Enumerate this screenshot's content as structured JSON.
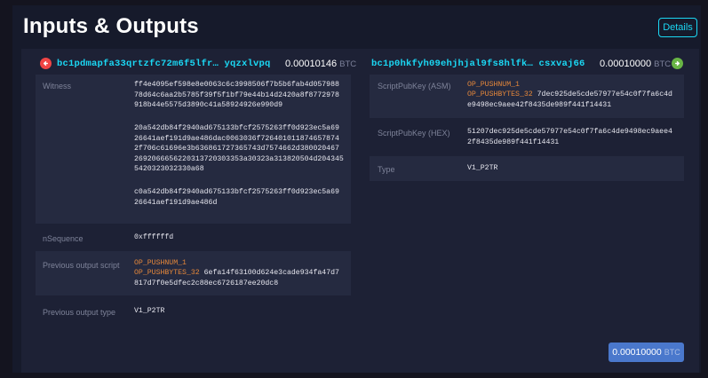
{
  "header": {
    "title": "Inputs & Outputs",
    "details_label": "Details"
  },
  "input": {
    "address": "bc1pdmapfa33qrtzfc72m6f5lfr… yqzxlvpq",
    "amount": "0.00010146",
    "unit": "BTC",
    "witness_label": "Witness",
    "witness_1": "ff4e4095ef598e8e0063c6c3998506f7b5b6fab4d057988\n78d64c6aa2b5785f39f5f1bf79e44b14d2420a8f8772978\n918b44e5575d3890c41a58924926e990d9",
    "witness_2": "20a542db84f2940ad675133bfcf2575263ff0d923ec5a69\n26641aef191d9ae486dac0063036f726401011874657874\n2f706c61696e3b636861727365743d7574662d380020467\n2692066656220313720303353a30323a313820504d204345\n5420323032330a68",
    "witness_3": "c0a542db84f2940ad675133bfcf2575263ff0d923ec5a69\n26641aef191d9ae486d",
    "nsequence_label": "nSequence",
    "nsequence": "0xffffffd",
    "prev_script_label": "Previous output script",
    "prev_script_op1": "OP_PUSHNUM_1",
    "prev_script_op2": "OP_PUSHBYTES_32",
    "prev_script_hex_a": "6efa14f63100d624e3cade934fa47d7",
    "prev_script_hex_b": "817d7f0e5dfec2c88ec6726187ee20dc8",
    "prev_type_label": "Previous output type",
    "prev_type": "V1_P2TR"
  },
  "output": {
    "address": "bc1p0hkfyh09ehjhjal9fs8hlfk… csxvaj66",
    "amount": "0.00010000",
    "unit": "BTC",
    "asm_label": "ScriptPubKey (ASM)",
    "asm_op1": "OP_PUSHNUM_1",
    "asm_op2": "OP_PUSHBYTES_32",
    "asm_hex_a": "7dec925de5cde57977e54c0f7fa6c4d",
    "asm_hex_b": "e9498ec9aee42f8435de989f441f14431",
    "hex_label": "ScriptPubKey (HEX)",
    "hex_value": "51207dec925de5cde57977e54c0f7fa6c4de9498ec9aee4\n2f8435de989f441f14431",
    "type_label": "Type",
    "type_value": "V1_P2TR"
  },
  "footer": {
    "total": "0.00010000",
    "unit": "BTC"
  },
  "colors": {
    "accent": "#1bd8f4",
    "input_icon": "#f04545",
    "output_icon": "#68b545",
    "op_code": "#e4873a",
    "total_button": "#4a78cc"
  },
  "icons": {
    "input": "arrow-left-circle-icon",
    "output": "arrow-right-circle-icon"
  }
}
